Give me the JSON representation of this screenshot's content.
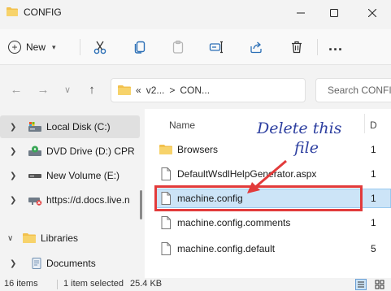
{
  "window": {
    "title": "CONFIG"
  },
  "toolbar": {
    "new_label": "New",
    "icons": [
      "cut-icon",
      "copy-icon",
      "paste-icon",
      "rename-icon",
      "share-icon",
      "delete-icon"
    ],
    "more_label": "..."
  },
  "nav": {
    "breadcrumb_prefix": "«",
    "breadcrumb_parts": [
      "v2...",
      "CON..."
    ],
    "breadcrumb_sep": ">",
    "search_placeholder": "Search CONFIG"
  },
  "sidebar": {
    "items": [
      {
        "label": "Local Disk (C:)",
        "icon": "local-disk-icon",
        "selected": true
      },
      {
        "label": "DVD Drive (D:) CPR",
        "icon": "dvd-drive-icon"
      },
      {
        "label": "New Volume (E:)",
        "icon": "drive-icon"
      },
      {
        "label": "https://d.docs.live.n",
        "icon": "network-drive-icon"
      },
      {
        "label": "Libraries",
        "icon": "libraries-icon"
      },
      {
        "label": "Documents",
        "icon": "documents-icon"
      }
    ]
  },
  "file_list": {
    "columns": {
      "name": "Name",
      "date": "D"
    },
    "rows": [
      {
        "name": "Browsers",
        "date": "1",
        "type": "folder"
      },
      {
        "name": "DefaultWsdlHelpGenerator.aspx",
        "date": "1",
        "type": "file"
      },
      {
        "name": "machine.config",
        "date": "1",
        "type": "file",
        "selected": true
      },
      {
        "name": "machine.config.comments",
        "date": "1",
        "type": "file"
      },
      {
        "name": "machine.config.default",
        "date": "5",
        "type": "file"
      }
    ]
  },
  "annotation": {
    "line1": "Delete this",
    "line2": "file",
    "color": "#2d3fa0",
    "box_color": "#e23b3b"
  },
  "status": {
    "count": "16 items",
    "selection": "1 item selected",
    "size": "25.4 KB"
  },
  "colors": {
    "selection_bg": "#cce4f7",
    "folder_yellow": "#f2c14e",
    "accent": "#0067c0"
  }
}
